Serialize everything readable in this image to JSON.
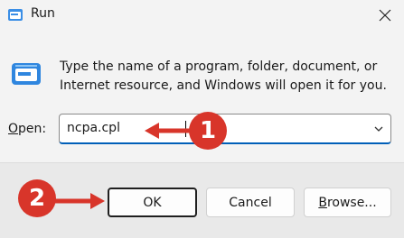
{
  "window": {
    "title": "Run",
    "app_icon": "run-icon",
    "close_icon": "close-icon"
  },
  "content": {
    "description": "Type the name of a program, folder, document, or Internet resource, and Windows will open it for you.",
    "open_label_accel": "O",
    "open_label_rest": "pen:",
    "open_value": "ncpa.cpl"
  },
  "buttons": {
    "ok": "OK",
    "cancel": "Cancel",
    "browse_accel": "B",
    "browse_rest": "rowse..."
  },
  "annotations": {
    "marker_1": "1",
    "marker_2": "2",
    "color": "#d8352a"
  }
}
